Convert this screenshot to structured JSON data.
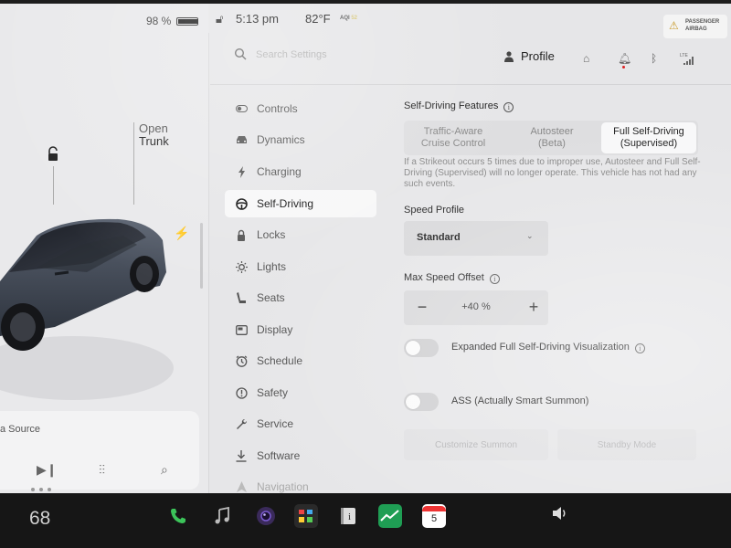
{
  "status": {
    "battery": "98 %",
    "battery_level": 0.98,
    "time": "5:13 pm",
    "temperature": "82°F",
    "aqi_label": "AQI",
    "aqi_value": "52",
    "airbag_line1": "PASSENGER",
    "airbag_line2": "AIRBAG"
  },
  "car": {
    "open_label": "Open",
    "trunk_label": "Trunk"
  },
  "media": {
    "source_label": "a Source"
  },
  "search": {
    "placeholder": "Search Settings"
  },
  "header": {
    "profile_label": "Profile",
    "lte_label": "LTE"
  },
  "sidebar": {
    "items": [
      {
        "label": "Controls",
        "icon": "toggle-icon"
      },
      {
        "label": "Dynamics",
        "icon": "car-icon"
      },
      {
        "label": "Charging",
        "icon": "bolt-icon"
      },
      {
        "label": "Self-Driving",
        "icon": "steering-wheel-icon"
      },
      {
        "label": "Locks",
        "icon": "lock-icon"
      },
      {
        "label": "Lights",
        "icon": "sun-icon"
      },
      {
        "label": "Seats",
        "icon": "seat-icon"
      },
      {
        "label": "Display",
        "icon": "display-icon"
      },
      {
        "label": "Schedule",
        "icon": "clock-icon"
      },
      {
        "label": "Safety",
        "icon": "info-icon"
      },
      {
        "label": "Service",
        "icon": "wrench-icon"
      },
      {
        "label": "Software",
        "icon": "download-icon"
      },
      {
        "label": "Navigation",
        "icon": "navigation-icon"
      }
    ],
    "active": "Self-Driving"
  },
  "self_driving": {
    "features_title": "Self-Driving Features",
    "options": [
      {
        "line1": "Traffic-Aware",
        "line2": "Cruise Control"
      },
      {
        "line1": "Autosteer",
        "line2": "(Beta)"
      },
      {
        "line1": "Full Self-Driving",
        "line2": "(Supervised)"
      }
    ],
    "selected_option": "Full Self-Driving (Supervised)",
    "strikeout_note": "If a Strikeout occurs 5 times due to improper use, Autosteer and Full Self-Driving (Supervised) will no longer operate. This vehicle has not had any such events.",
    "speed_profile_title": "Speed Profile",
    "speed_profile_value": "Standard",
    "max_speed_offset_title": "Max Speed Offset",
    "max_speed_offset_value": "+40 %",
    "minus_label": "−",
    "plus_label": "+",
    "expanded_viz_label": "Expanded Full Self-Driving Visualization",
    "expanded_viz_on": false,
    "ass_label": "ASS (Actually Smart Summon)",
    "ass_on": false,
    "customize_summon_label": "Customize Summon",
    "standby_mode_label": "Standby Mode"
  },
  "taskbar": {
    "cabin_temp": "68",
    "calendar_day": "5",
    "apps": [
      "phone-icon",
      "music-icon",
      "camera-icon",
      "arcade-icon",
      "manual-icon",
      "stocks-icon",
      "calendar-icon"
    ]
  },
  "colors": {
    "phone": "#3cc45a",
    "stocks": "#1f9e54",
    "calendar": "#ffffff",
    "accent_airbag": "#c89a2a"
  }
}
